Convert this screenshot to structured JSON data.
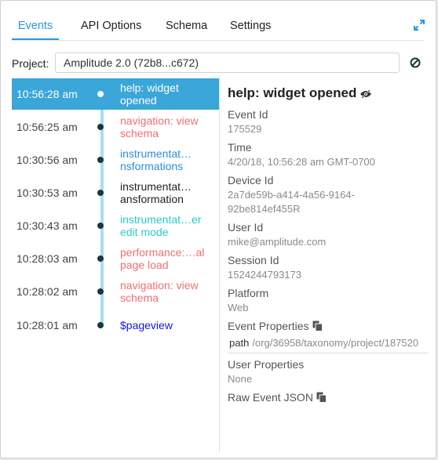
{
  "tabs": [
    {
      "label": "Events",
      "active": true
    },
    {
      "label": "API Options",
      "active": false
    },
    {
      "label": "Schema",
      "active": false
    },
    {
      "label": "Settings",
      "active": false
    }
  ],
  "project": {
    "label": "Project:",
    "value": "Amplitude 2.0 (72b8...c672)"
  },
  "events": [
    {
      "time": "10:56:28 am",
      "name": "help: widget\nopened",
      "color": "#ffffff",
      "selected": true
    },
    {
      "time": "10:56:25 am",
      "name": "navigation: view\nschema",
      "color": "#ee6f73",
      "selected": false
    },
    {
      "time": "10:30:56 am",
      "name": "instrumentat…\nnsformations",
      "color": "#2b8fd8",
      "selected": false
    },
    {
      "time": "10:30:53 am",
      "name": "instrumentat…\nansformation",
      "color": "#222222",
      "selected": false
    },
    {
      "time": "10:30:43 am",
      "name": "instrumentat…er\nedit mode",
      "color": "#2bc9c9",
      "selected": false
    },
    {
      "time": "10:28:03 am",
      "name": "performance:…al\npage load",
      "color": "#ee6f73",
      "selected": false
    },
    {
      "time": "10:28:02 am",
      "name": "navigation: view\nschema",
      "color": "#ee6f73",
      "selected": false
    },
    {
      "time": "10:28:01 am",
      "name": "$pageview",
      "color": "#1414e6",
      "selected": false
    }
  ],
  "details": {
    "title": "help: widget opened",
    "event_id_label": "Event Id",
    "event_id": "175529",
    "time_label": "Time",
    "time": "4/20/18, 10:56:28 am GMT-0700",
    "device_id_label": "Device Id",
    "device_id_line1": "2a7de59b-a414-4a56-9164-",
    "device_id_line2": "92be814ef455R",
    "user_id_label": "User Id",
    "user_id": "mike@amplitude.com",
    "session_id_label": "Session Id",
    "session_id": "1524244793173",
    "platform_label": "Platform",
    "platform": "Web",
    "event_properties_label": "Event Properties",
    "prop_key": "path",
    "prop_value": "/org/36958/taxonomy/project/187520",
    "user_properties_label": "User Properties",
    "user_properties": "None",
    "raw_event_label": "Raw Event JSON"
  },
  "icons": [
    "expand-icon",
    "ban-icon",
    "eye-slash-icon",
    "copy-icon"
  ],
  "colors": {
    "accent": "#2b9ad6",
    "selected_row": "#3ba6d8",
    "timeline": "#a9dcf5"
  }
}
